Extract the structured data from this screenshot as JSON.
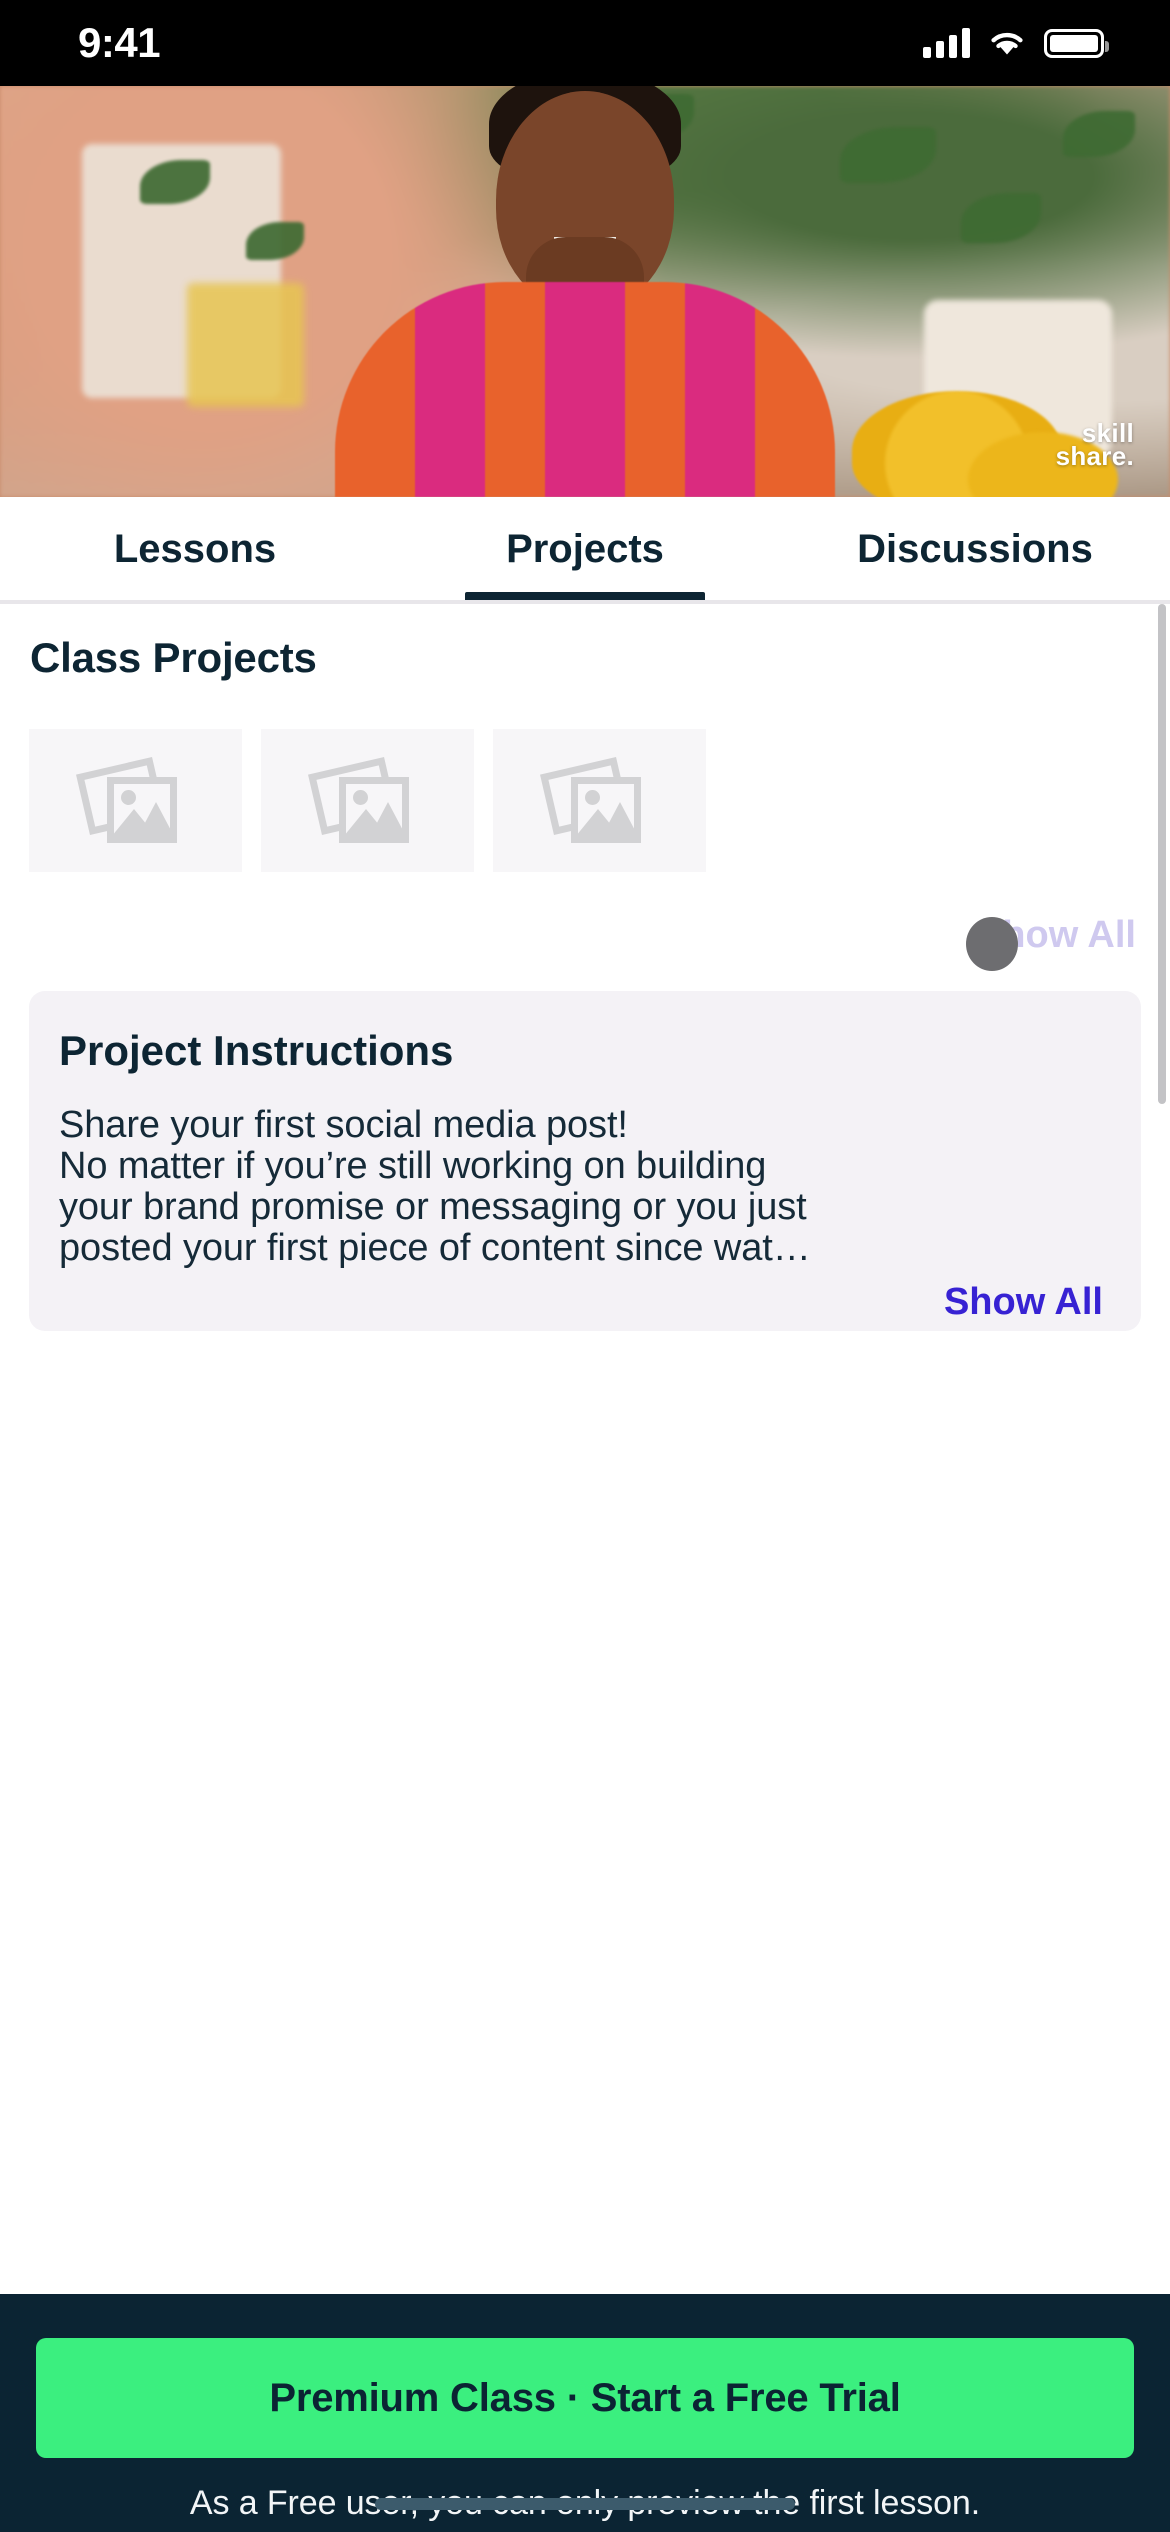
{
  "status_bar": {
    "time": "9:41",
    "cellular_icon": "cellular-bars-icon",
    "wifi_icon": "wifi-icon",
    "battery_icon": "battery-icon"
  },
  "hero": {
    "brand_line1": "skill",
    "brand_line2": "share.",
    "alt": "instructor-video-thumbnail"
  },
  "tabs": {
    "items": [
      {
        "label": "Lessons",
        "active": false
      },
      {
        "label": "Projects",
        "active": true
      },
      {
        "label": "Discussions",
        "active": false
      }
    ]
  },
  "projects": {
    "section_title": "Class Projects",
    "thumbnails": [
      {
        "placeholder_icon": "image-placeholder-icon"
      },
      {
        "placeholder_icon": "image-placeholder-icon"
      },
      {
        "placeholder_icon": "image-placeholder-icon"
      }
    ],
    "show_all_label": "Show All",
    "loading_indicator": "loading-spinner"
  },
  "instructions": {
    "title": "Project Instructions",
    "line1": "Share your first social media post!",
    "line2": "No matter if you’re still working on building",
    "line3": "your brand promise or messaging or you just",
    "line4": "posted your first piece of content since wat…",
    "show_all_label": "Show All"
  },
  "cta": {
    "button_label": "Premium Class · Start a Free Trial",
    "note": "As a Free user, you can only preview the first lesson."
  },
  "colors": {
    "navy": "#0b2433",
    "green": "#3bef7f",
    "purple": "#3722d3",
    "purple_faded": "#cfc9ef",
    "card_bg": "#f4f2f6",
    "thumb_bg": "#f7f6f8"
  }
}
